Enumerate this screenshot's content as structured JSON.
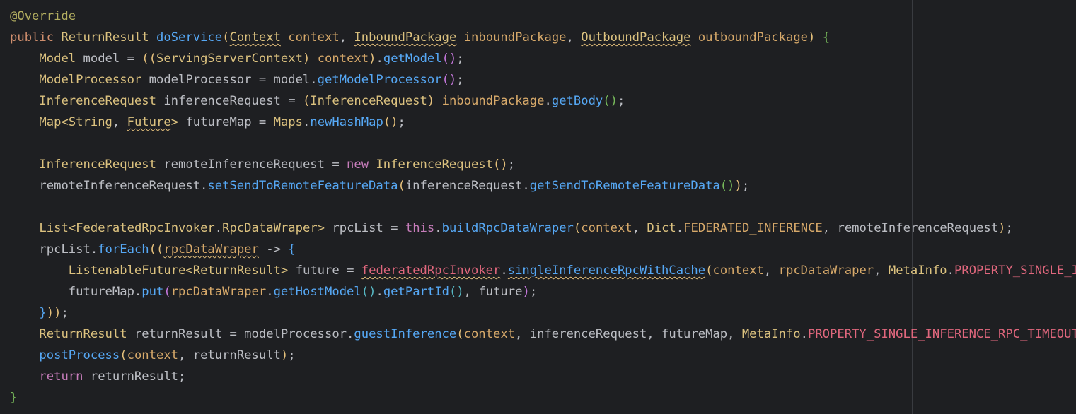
{
  "editor": {
    "theme": "dark",
    "background": "#1e1f22",
    "lines": [
      {
        "indent": 0,
        "tokens": [
          {
            "t": "@Override",
            "c": "ann"
          }
        ]
      },
      {
        "indent": 0,
        "tokens": [
          {
            "t": "public ",
            "c": "kw"
          },
          {
            "t": "ReturnResult",
            "c": "cls"
          },
          {
            "t": " "
          },
          {
            "t": "doService",
            "c": "fn"
          },
          {
            "t": "(",
            "c": "paren1"
          },
          {
            "t": "Context",
            "c": "cls squig"
          },
          {
            "t": " "
          },
          {
            "t": "context",
            "c": "param"
          },
          {
            "t": ", "
          },
          {
            "t": "InboundPackage",
            "c": "cls squig"
          },
          {
            "t": " "
          },
          {
            "t": "inboundPackage",
            "c": "param"
          },
          {
            "t": ", "
          },
          {
            "t": "OutboundPackage",
            "c": "cls squig"
          },
          {
            "t": " "
          },
          {
            "t": "outboundPackage",
            "c": "param"
          },
          {
            "t": ")",
            "c": "paren1"
          },
          {
            "t": " "
          },
          {
            "t": "{",
            "c": "brace"
          }
        ]
      },
      {
        "indent": 1,
        "tokens": [
          {
            "t": "Model",
            "c": "cls"
          },
          {
            "t": " model = "
          },
          {
            "t": "((",
            "c": "paren1"
          },
          {
            "t": "ServingServerContext",
            "c": "cls"
          },
          {
            "t": ")",
            "c": "paren1"
          },
          {
            "t": " "
          },
          {
            "t": "context",
            "c": "param"
          },
          {
            "t": ")",
            "c": "paren1"
          },
          {
            "t": "."
          },
          {
            "t": "getModel",
            "c": "fn"
          },
          {
            "t": "()",
            "c": "paren2"
          },
          {
            "t": ";"
          }
        ]
      },
      {
        "indent": 1,
        "tokens": [
          {
            "t": "ModelProcessor",
            "c": "cls"
          },
          {
            "t": " modelProcessor = model."
          },
          {
            "t": "getModelProcessor",
            "c": "fn"
          },
          {
            "t": "()",
            "c": "paren2"
          },
          {
            "t": ";"
          }
        ]
      },
      {
        "indent": 1,
        "tokens": [
          {
            "t": "InferenceRequest",
            "c": "cls"
          },
          {
            "t": " inferenceRequest = "
          },
          {
            "t": "(",
            "c": "paren1"
          },
          {
            "t": "InferenceRequest",
            "c": "cls"
          },
          {
            "t": ")",
            "c": "paren1"
          },
          {
            "t": " "
          },
          {
            "t": "inboundPackage",
            "c": "param"
          },
          {
            "t": "."
          },
          {
            "t": "getBody",
            "c": "fn"
          },
          {
            "t": "()",
            "c": "brace"
          },
          {
            "t": ";"
          }
        ]
      },
      {
        "indent": 1,
        "tokens": [
          {
            "t": "Map",
            "c": "cls"
          },
          {
            "t": "<",
            "c": "cls"
          },
          {
            "t": "String",
            "c": "cls"
          },
          {
            "t": ", "
          },
          {
            "t": "Future",
            "c": "cls squig"
          },
          {
            "t": ">",
            "c": "cls"
          },
          {
            "t": " futureMap = "
          },
          {
            "t": "Maps",
            "c": "cls"
          },
          {
            "t": "."
          },
          {
            "t": "newHashMap",
            "c": "fn"
          },
          {
            "t": "()",
            "c": "paren1"
          },
          {
            "t": ";"
          }
        ]
      },
      {
        "indent": 0,
        "tokens": []
      },
      {
        "indent": 1,
        "tokens": [
          {
            "t": "InferenceRequest",
            "c": "cls"
          },
          {
            "t": " remoteInferenceRequest = "
          },
          {
            "t": "new ",
            "c": "const"
          },
          {
            "t": "InferenceRequest",
            "c": "cls"
          },
          {
            "t": "()",
            "c": "paren1"
          },
          {
            "t": ";"
          }
        ]
      },
      {
        "indent": 1,
        "tokens": [
          {
            "t": "remoteInferenceRequest."
          },
          {
            "t": "setSendToRemoteFeatureData",
            "c": "fn"
          },
          {
            "t": "(",
            "c": "paren1"
          },
          {
            "t": "inferenceRequest."
          },
          {
            "t": "getSendToRemoteFeatureData",
            "c": "fn"
          },
          {
            "t": "()",
            "c": "brace"
          },
          {
            "t": ")",
            "c": "paren1"
          },
          {
            "t": ";"
          }
        ]
      },
      {
        "indent": 0,
        "tokens": []
      },
      {
        "indent": 1,
        "tokens": [
          {
            "t": "List",
            "c": "cls"
          },
          {
            "t": "<",
            "c": "cls"
          },
          {
            "t": "FederatedRpcInvoker",
            "c": "cls"
          },
          {
            "t": "."
          },
          {
            "t": "RpcDataWraper",
            "c": "cls"
          },
          {
            "t": ">",
            "c": "cls"
          },
          {
            "t": " rpcList = "
          },
          {
            "t": "this",
            "c": "const"
          },
          {
            "t": "."
          },
          {
            "t": "buildRpcDataWraper",
            "c": "fn"
          },
          {
            "t": "(",
            "c": "paren1"
          },
          {
            "t": "context",
            "c": "param"
          },
          {
            "t": ", "
          },
          {
            "t": "Dict",
            "c": "cls"
          },
          {
            "t": "."
          },
          {
            "t": "FEDERATED_INFERENCE",
            "c": "param"
          },
          {
            "t": ", "
          },
          {
            "t": "remoteInferenceRequest"
          },
          {
            "t": ")",
            "c": "paren1"
          },
          {
            "t": ";"
          }
        ]
      },
      {
        "indent": 1,
        "tokens": [
          {
            "t": "rpcList."
          },
          {
            "t": "forEach",
            "c": "fn"
          },
          {
            "t": "((",
            "c": "paren1"
          },
          {
            "t": "rpcDataWraper",
            "c": "param squig"
          },
          {
            "t": " -> "
          },
          {
            "t": "{",
            "c": "fn"
          }
        ]
      },
      {
        "indent": 2,
        "tokens": [
          {
            "t": "ListenableFuture",
            "c": "cls"
          },
          {
            "t": "<",
            "c": "cls"
          },
          {
            "t": "ReturnResult",
            "c": "cls"
          },
          {
            "t": ">",
            "c": "cls"
          },
          {
            "t": " future = "
          },
          {
            "t": "federatedRpcInvoker",
            "c": "err squig"
          },
          {
            "t": "."
          },
          {
            "t": "singleInferenceRpcWithCache",
            "c": "fn squig"
          },
          {
            "t": "(",
            "c": "paren1"
          },
          {
            "t": "context",
            "c": "param"
          },
          {
            "t": ", "
          },
          {
            "t": "rpcDataWraper",
            "c": "param"
          },
          {
            "t": ", "
          },
          {
            "t": "MetaInfo",
            "c": "cls"
          },
          {
            "t": "."
          },
          {
            "t": "PROPERTY_SINGLE_INFERENCE_RPC_TIMEOUT",
            "c": "static-f"
          }
        ]
      },
      {
        "indent": 2,
        "tokens": [
          {
            "t": "futureMap."
          },
          {
            "t": "put",
            "c": "fn"
          },
          {
            "t": "(",
            "c": "paren2"
          },
          {
            "t": "rpcDataWraper",
            "c": "param"
          },
          {
            "t": "."
          },
          {
            "t": "getHostModel",
            "c": "fn"
          },
          {
            "t": "()",
            "c": "paren3"
          },
          {
            "t": "."
          },
          {
            "t": "getPartId",
            "c": "fn"
          },
          {
            "t": "()",
            "c": "paren3"
          },
          {
            "t": ", future"
          },
          {
            "t": ")",
            "c": "paren2"
          },
          {
            "t": ";"
          }
        ]
      },
      {
        "indent": 1,
        "tokens": [
          {
            "t": "}",
            "c": "fn"
          },
          {
            "t": "))",
            "c": "paren1"
          },
          {
            "t": ";"
          }
        ]
      },
      {
        "indent": 1,
        "tokens": [
          {
            "t": "ReturnResult",
            "c": "cls"
          },
          {
            "t": " returnResult = modelProcessor."
          },
          {
            "t": "guestInference",
            "c": "fn"
          },
          {
            "t": "(",
            "c": "paren1"
          },
          {
            "t": "context",
            "c": "param"
          },
          {
            "t": ", inferenceRequest, futureMap, "
          },
          {
            "t": "MetaInfo",
            "c": "cls"
          },
          {
            "t": "."
          },
          {
            "t": "PROPERTY_SINGLE_INFERENCE_RPC_TIMEOUT",
            "c": "static-f"
          }
        ]
      },
      {
        "indent": 1,
        "tokens": [
          {
            "t": "postProcess",
            "c": "fn"
          },
          {
            "t": "(",
            "c": "paren1"
          },
          {
            "t": "context",
            "c": "param"
          },
          {
            "t": ", returnResult"
          },
          {
            "t": ")",
            "c": "paren1"
          },
          {
            "t": ";"
          }
        ]
      },
      {
        "indent": 1,
        "tokens": [
          {
            "t": "return ",
            "c": "const"
          },
          {
            "t": "returnResult;"
          }
        ]
      },
      {
        "indent": 0,
        "tokens": [
          {
            "t": "}",
            "c": "brace"
          }
        ]
      }
    ]
  }
}
